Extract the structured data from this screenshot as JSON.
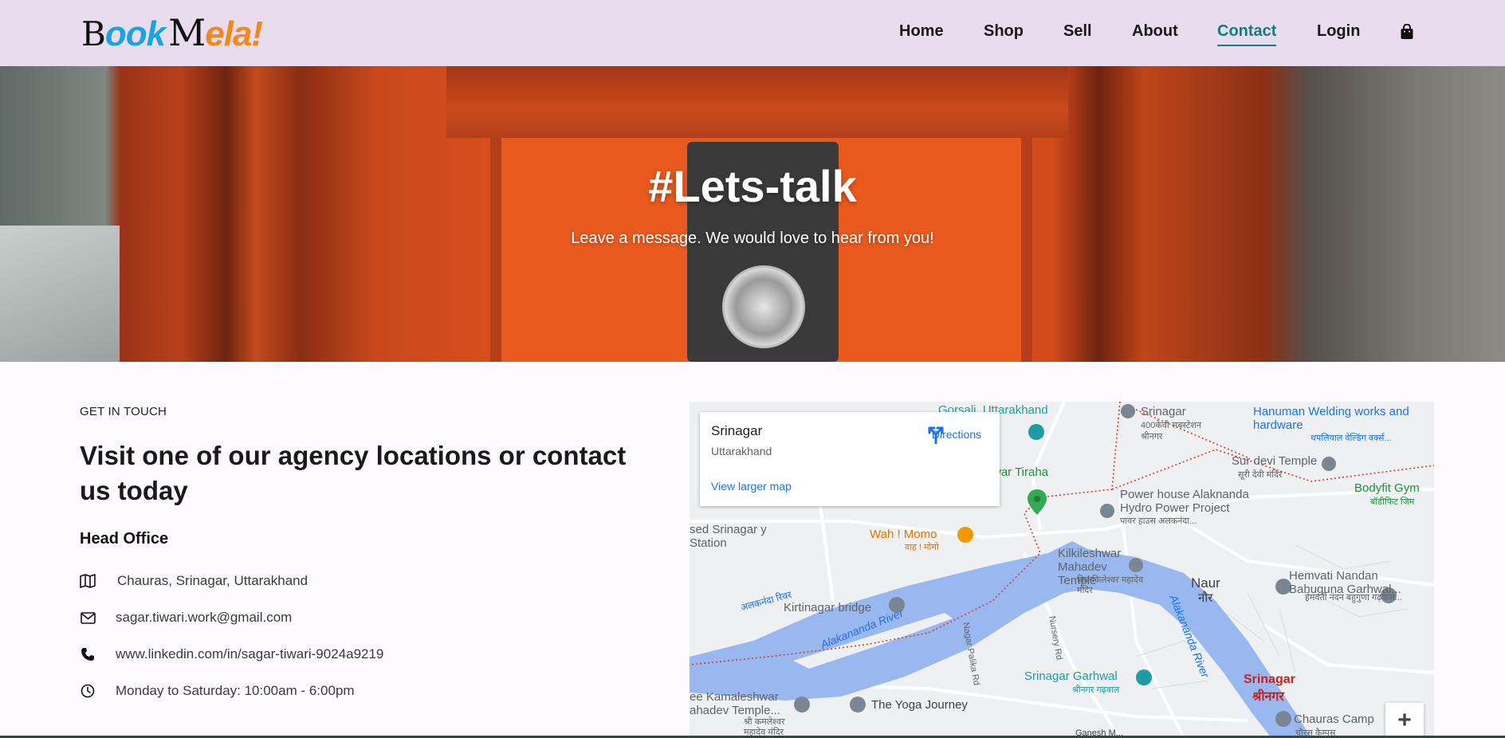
{
  "header": {
    "logo": {
      "b": "B",
      "ook": "ook",
      "m": "M",
      "ela": "ela!"
    },
    "nav": [
      {
        "label": "Home",
        "active": false
      },
      {
        "label": "Shop",
        "active": false
      },
      {
        "label": "Sell",
        "active": false
      },
      {
        "label": "About",
        "active": false
      },
      {
        "label": "Contact",
        "active": true
      },
      {
        "label": "Login",
        "active": false
      }
    ],
    "cart_icon": "shopping-bag-icon"
  },
  "hero": {
    "title": "#Lets-talk",
    "subtitle": "Leave a message. We would love to hear from you!"
  },
  "contact": {
    "kicker": "GET IN TOUCH",
    "heading": "Visit one of our agency locations or contact us today",
    "office_title": "Head Office",
    "items": [
      {
        "icon": "map-icon",
        "text": "Chauras, Srinagar, Uttarakhand"
      },
      {
        "icon": "envelope-icon",
        "text": "sagar.tiwari.work@gmail.com"
      },
      {
        "icon": "phone-icon",
        "text": "www.linkedin.com/in/sagar-tiwari-9024a9219"
      },
      {
        "icon": "clock-icon",
        "text": "Monday to Saturday: 10:00am - 6:00pm"
      }
    ]
  },
  "map": {
    "place": "Srinagar",
    "region": "Uttarakhand",
    "directions": "Directions",
    "larger_map": "View larger map",
    "labels": [
      "Gorsali, Uttarakhand",
      "Srinagar",
      "400केवी सबस्टेशन",
      "श्रीनगर",
      "Hanuman Welding works and hardware",
      "थपलियाल वेल्डिंग वर्क्स...",
      "Sur devi Temple",
      "सूरी देवी मंदिर",
      "war Tiraha",
      "Power house Alaknanda Hydro Power Project",
      "पावर हाउस अलकनंदा...",
      "Bodyfit Gym",
      "बॉडीफिट जिम",
      "sed Srinagar y Station",
      "Wah ! Momo",
      "वाह ! मोमो",
      "Kilkileshwar Mahadev Temple",
      "किलकिलेश्वर महादेव मंदिर",
      "Naur",
      "नौर",
      "Hemvati Nandan Bahuguna Garhwal...",
      "हेमवती नंदन बहुगुणा गढ़वाल...",
      "Kirtinagar bridge",
      "अलकनंदा रिवर",
      "Alakananda River",
      "Nagar Palika Rd",
      "Nursery Rd",
      "Alakananda River",
      "Srinagar Garhwal",
      "श्रीनगर गढ़वाल",
      "Srinagar",
      "श्रीनगर",
      "ee Kamaleshwar ahadev Temple...",
      "श्री कमलेश्वर महादेव मंदिर",
      "The Yoga Journey",
      "Chauras Camp",
      "चौरस कैम्पस",
      "Ganesh M..."
    ],
    "zoom_in": "+"
  },
  "colors": {
    "header_bg": "#e8dcee",
    "accent": "#0f7f7a",
    "logo_blue": "#1aa3e0",
    "logo_orange": "#f08a1c",
    "map_link": "#1a73e8",
    "river": "#9ab8f0"
  }
}
